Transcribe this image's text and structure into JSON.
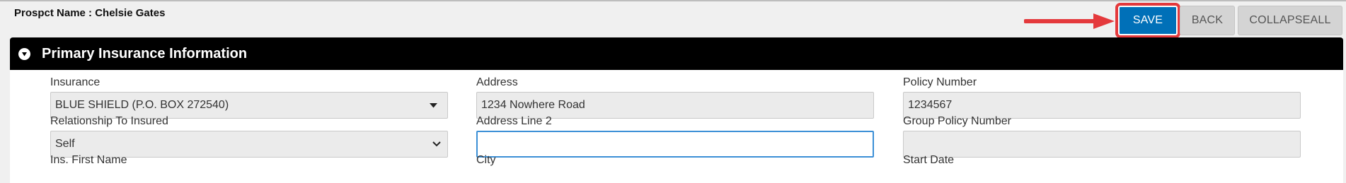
{
  "header": {
    "prospect_label": "Prospct Name : Chelsie Gates"
  },
  "toolbar": {
    "save_label": "SAVE",
    "back_label": "BACK",
    "collapse_label": "COLLAPSEALL"
  },
  "panel": {
    "title": "Primary Insurance Information"
  },
  "form": {
    "insurance_label": "Insurance",
    "insurance_value": "BLUE SHIELD (P.O. BOX 272540)",
    "address_label": "Address",
    "address_value": "1234 Nowhere Road",
    "policy_number_label": "Policy Number",
    "policy_number_value": "1234567",
    "relationship_label": "Relationship To Insured",
    "relationship_value": "Self",
    "address2_label": "Address Line 2",
    "address2_value": "",
    "group_policy_label": "Group Policy Number",
    "group_policy_value": "",
    "ins_first_name_label": "Ins. First Name",
    "city_label": "City",
    "start_date_label": "Start Date"
  },
  "colors": {
    "save_bg": "#0070b8",
    "highlight": "#e4393c",
    "header_bg": "#000000"
  }
}
